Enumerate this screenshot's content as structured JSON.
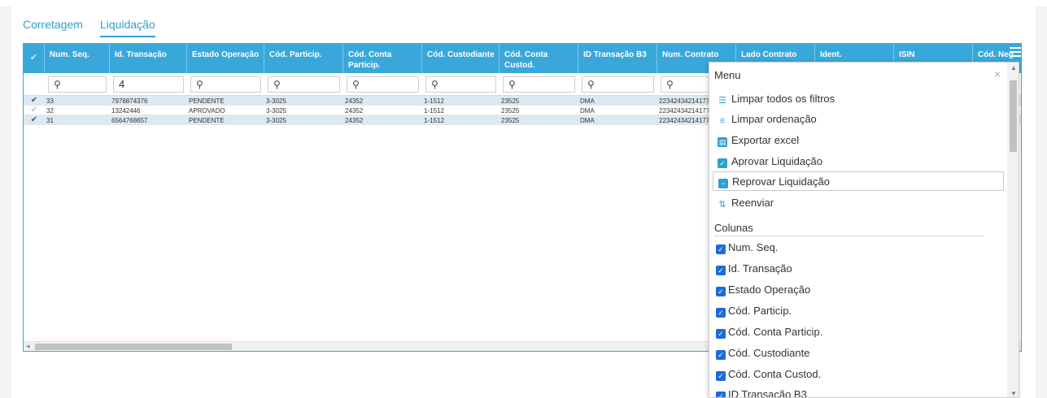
{
  "tabs": [
    {
      "label": "Corretagem",
      "active": false
    },
    {
      "label": "Liquidação",
      "active": true
    }
  ],
  "colors": {
    "accent": "#3aa7da",
    "selected_row": "#dbe9f3",
    "checkbox": "#1c6bd8"
  },
  "grid": {
    "columns": [
      {
        "line1": "Num. Seq.",
        "line2": ""
      },
      {
        "line1": "Id. Transação",
        "line2": ""
      },
      {
        "line1": "Estado Operação",
        "line2": ""
      },
      {
        "line1": "Cód. Particip.",
        "line2": ""
      },
      {
        "line1": "Cód. Conta",
        "line2": "Particip."
      },
      {
        "line1": "Cód. Custodiante",
        "line2": ""
      },
      {
        "line1": "Cód. Conta",
        "line2": "Custod."
      },
      {
        "line1": "ID Transação B3",
        "line2": ""
      },
      {
        "line1": "Num. Contrato",
        "line2": ""
      },
      {
        "line1": "Lado Contrato",
        "line2": ""
      },
      {
        "line1": "Ident.",
        "line2": ""
      },
      {
        "line1": "ISIN",
        "line2": ""
      },
      {
        "line1": "Cód. Neg",
        "line2": ""
      }
    ],
    "filters": [
      "",
      "4",
      "",
      "",
      "",
      "",
      "",
      "",
      ""
    ],
    "rows": [
      {
        "checked": true,
        "selected": true,
        "cells": [
          "33",
          "7976874376",
          "PENDENTE",
          "3-3025",
          "24352",
          "1-1512",
          "23525",
          "DMA",
          "22342434214177"
        ]
      },
      {
        "checked": false,
        "selected": false,
        "cells": [
          "32",
          "13242446",
          "APROVADO",
          "3-3025",
          "24352",
          "1-1512",
          "23525",
          "DMA",
          "22342434214177"
        ]
      },
      {
        "checked": true,
        "selected": true,
        "cells": [
          "31",
          "6564768657",
          "PENDENTE",
          "3-3025",
          "24352",
          "1-1512",
          "23525",
          "DMA",
          "22342434214177"
        ]
      }
    ]
  },
  "menu": {
    "title": "Menu",
    "close": "×",
    "items": [
      {
        "label": "Limpar todos os filtros",
        "icon": "filter-icon"
      },
      {
        "label": "Limpar ordenação",
        "icon": "sort-icon"
      },
      {
        "label": "Exportar excel",
        "icon": "file-icon"
      },
      {
        "label": "Aprovar Liquidação",
        "icon": "check-box-icon"
      },
      {
        "label": "Reprovar Liquidação",
        "icon": "minus-box-icon"
      },
      {
        "label": "Reenviar",
        "icon": "resend-icon"
      }
    ],
    "columns_section": "Colunas",
    "columns": [
      "Num. Seq.",
      "Id. Transação",
      "Estado Operação",
      "Cód. Particip.",
      "Cód. Conta Particip.",
      "Cód. Custodiante",
      "Cód. Conta Custod.",
      "ID Transação B3"
    ]
  }
}
